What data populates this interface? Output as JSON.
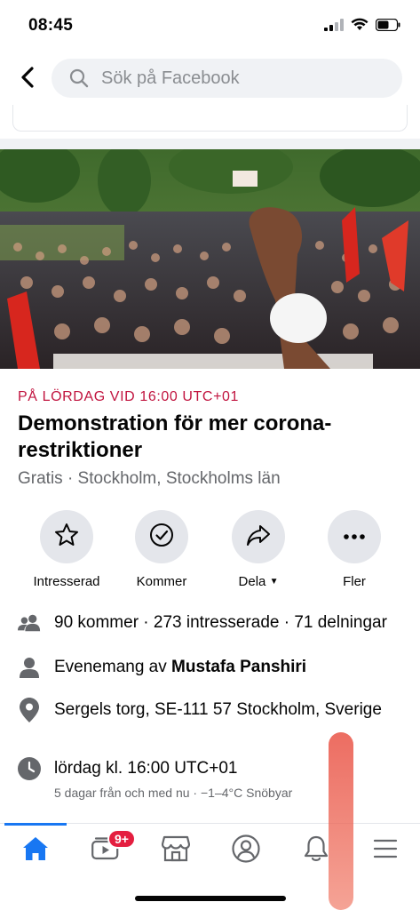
{
  "status_bar": {
    "time": "08:45"
  },
  "search": {
    "placeholder": "Sök på Facebook"
  },
  "event": {
    "date_line": "PÅ LÖRDAG VID 16:00 UTC+01",
    "title": "Demonstration för mer corona-restriktioner",
    "subtitle": "Gratis · Stockholm, Stockholms län"
  },
  "actions": [
    {
      "label": "Intresserad",
      "icon": "star-icon"
    },
    {
      "label": "Kommer",
      "icon": "check-circle-icon"
    },
    {
      "label": "Dela",
      "icon": "share-icon"
    },
    {
      "label": "Fler",
      "icon": "more-icon"
    }
  ],
  "info": {
    "attendance": "90 kommer · 273 intresserade · 71 delningar",
    "host_prefix": "Evenemang av ",
    "host_name": "Mustafa Panshiri",
    "location": "Sergels torg, SE-111 57 Stockholm, Sverige",
    "time": "lördag kl. 16:00 UTC+01",
    "time_detail": "5 dagar från och med nu · −1–4°C Snöbyar"
  },
  "tabbar": {
    "video_badge": "9+",
    "items": [
      "home-icon",
      "video-icon",
      "marketplace-icon",
      "profile-icon",
      "notifications-icon",
      "menu-icon"
    ]
  },
  "colors": {
    "accent": "#1877f2",
    "date_red": "#c1143f",
    "badge_red": "#e41e3f",
    "button_bg": "#e4e6eb"
  }
}
